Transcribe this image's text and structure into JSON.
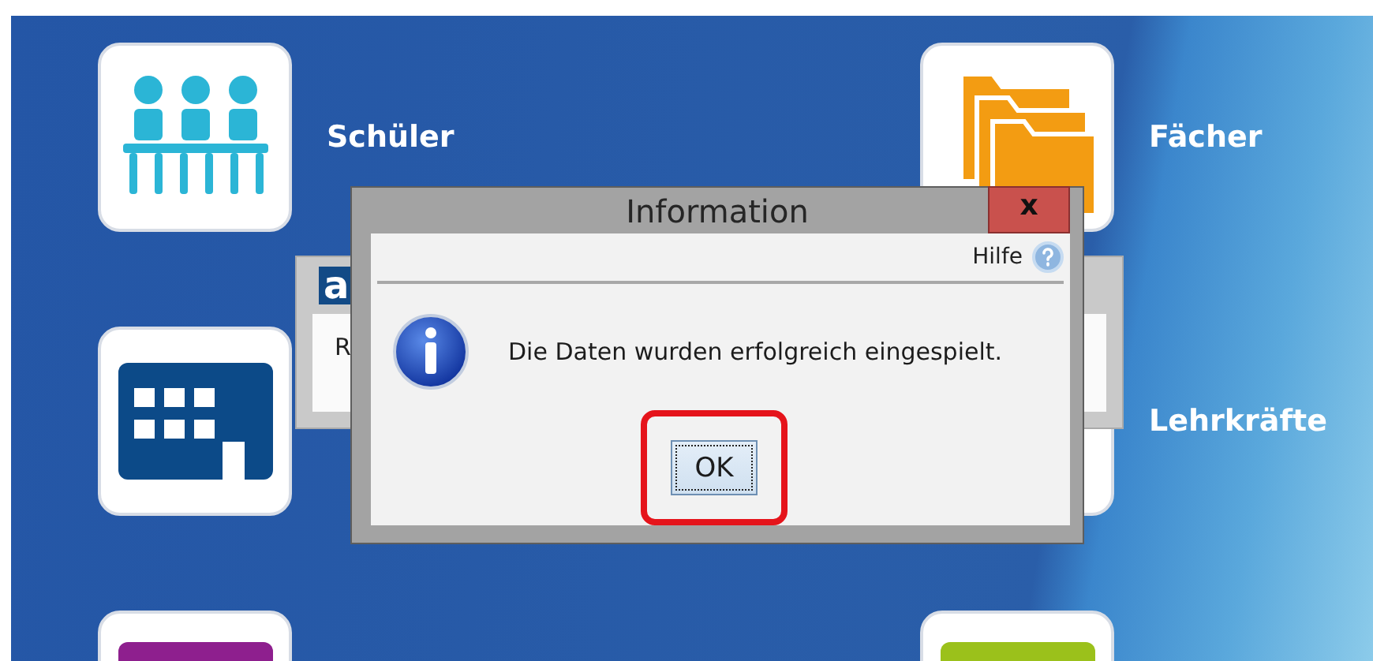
{
  "desktop": {
    "tiles": [
      {
        "kind": "students",
        "label": "Schüler"
      },
      {
        "kind": "subjects",
        "label": "Fächer"
      },
      {
        "kind": "building"
      },
      {
        "kind": "teachers",
        "label": "Lehrkräfte"
      },
      {
        "kind": "purple"
      },
      {
        "kind": "green"
      }
    ]
  },
  "background_window": {
    "logo": "a",
    "text": "R"
  },
  "dialog": {
    "title": "Information",
    "close": "x",
    "help": "Hilfe",
    "message": "Die Daten wurden erfolgreich eingespielt.",
    "buttons": [
      {
        "label": "OK",
        "focused": true,
        "highlighted": true
      }
    ]
  }
}
